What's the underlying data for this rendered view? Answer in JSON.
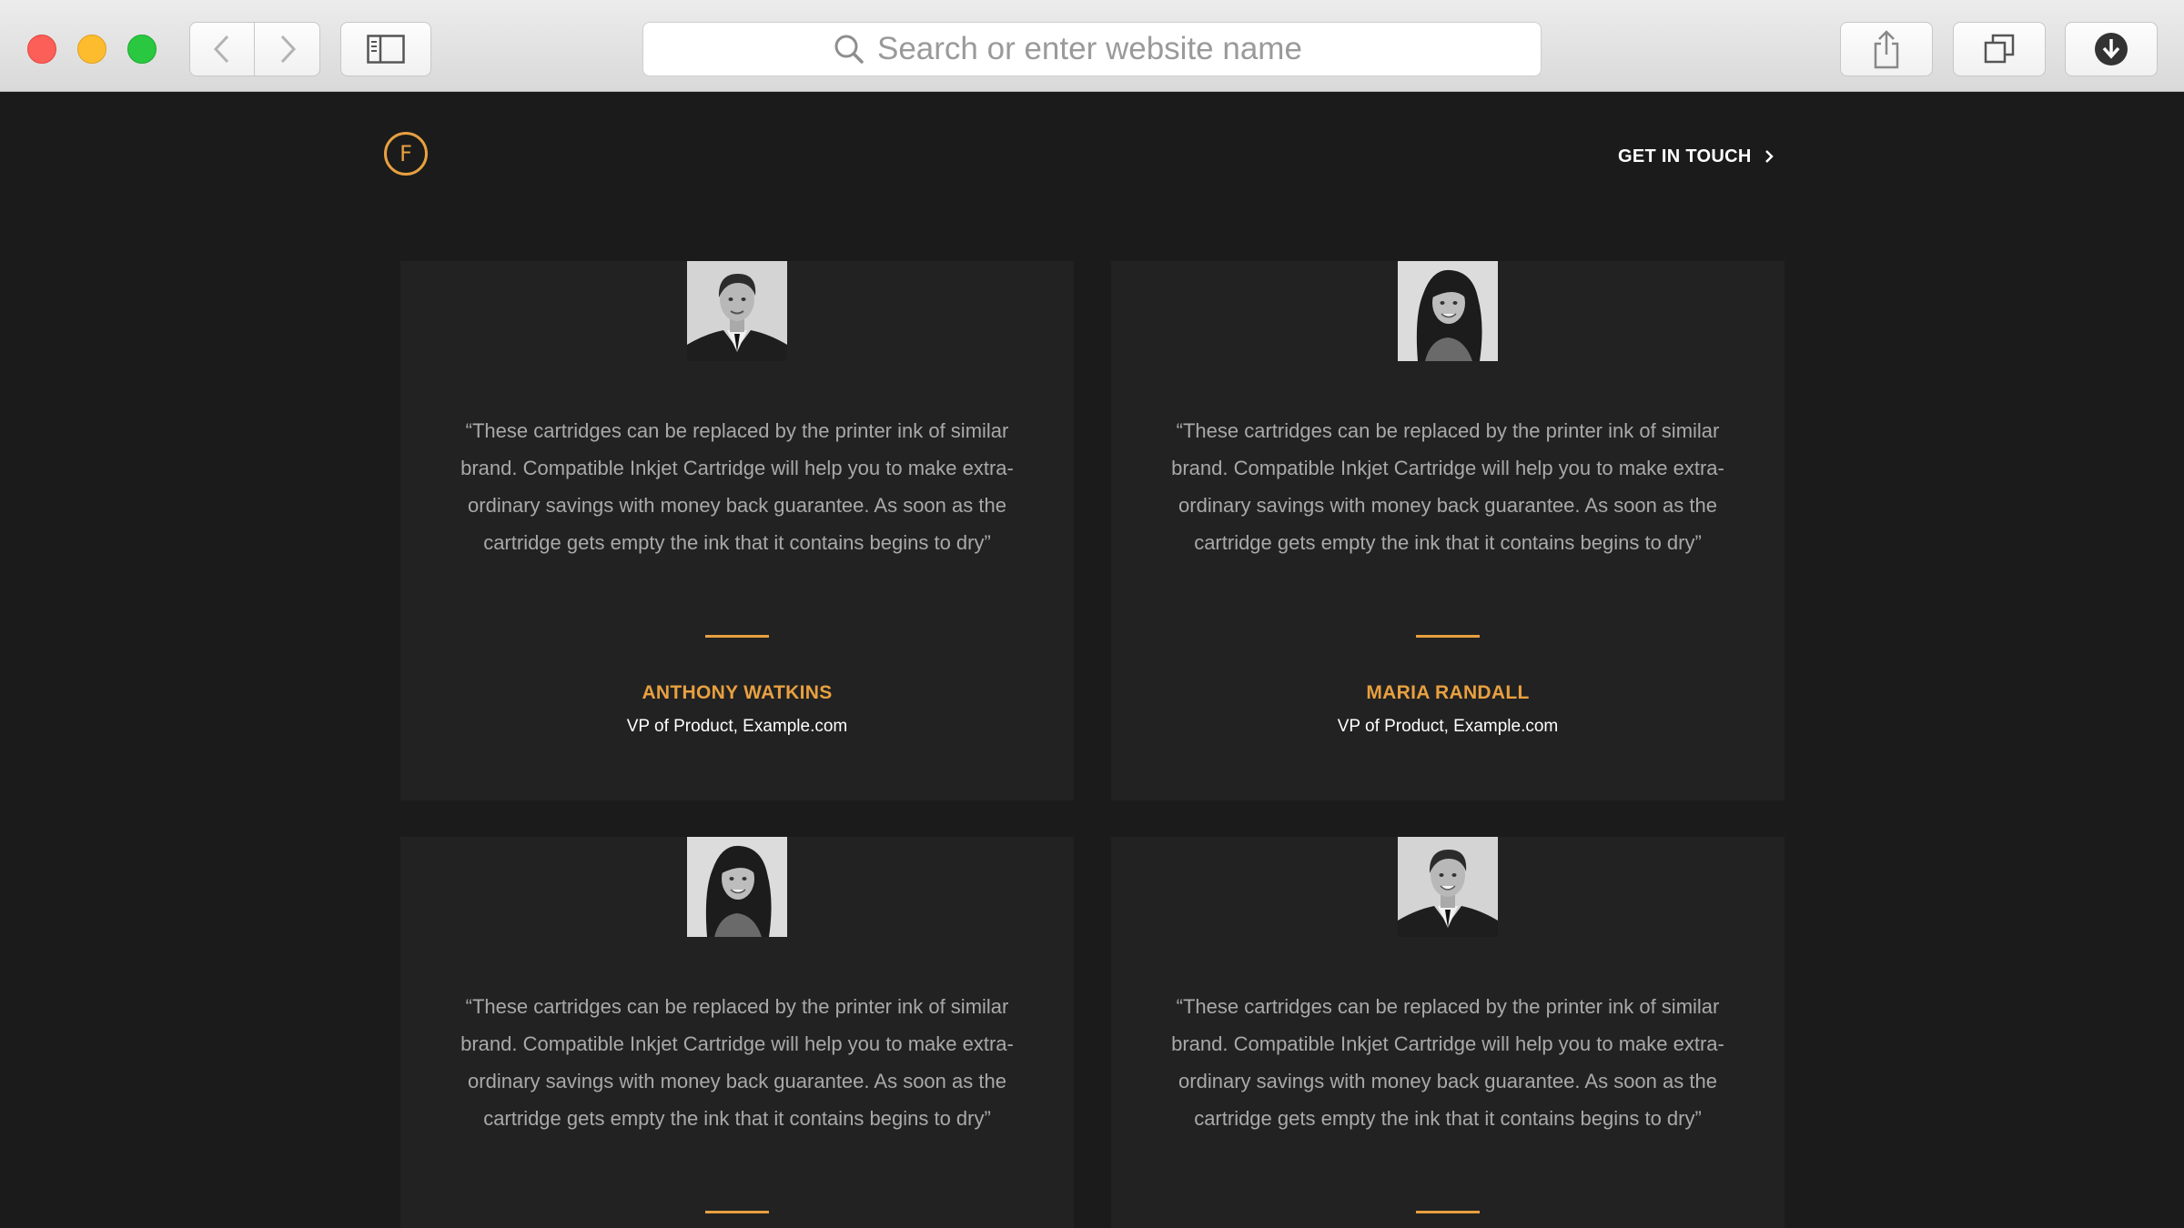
{
  "browser": {
    "address_placeholder": "Search or enter website name"
  },
  "site": {
    "logo_letter": "F",
    "nav_cta": "GET IN TOUCH"
  },
  "testimonials": [
    {
      "quote": "“These cartridges can be replaced by the printer ink of similar brand. Compatible Inkjet Cartridge will help you to make extra-ordinary savings with money back guarantee. As soon as the cartridge gets empty the ink that it contains begins to dry”",
      "name": "ANTHONY WATKINS",
      "role": "VP of Product, Example.com",
      "avatar": "man-portrait"
    },
    {
      "quote": "“These cartridges can be replaced by the printer ink of similar brand. Compatible Inkjet Cartridge will help you to make extra-ordinary savings with money back guarantee. As soon as the cartridge gets empty the ink that it contains begins to dry”",
      "name": "MARIA RANDALL",
      "role": "VP of Product, Example.com",
      "avatar": "woman-portrait"
    },
    {
      "quote": "“These cartridges can be replaced by the printer ink of similar brand. Compatible Inkjet Cartridge will help you to make extra-ordinary savings with money back guarantee. As soon as the cartridge gets empty the ink that it contains begins to dry”",
      "avatar": "woman-portrait"
    },
    {
      "quote": "“These cartridges can be replaced by the printer ink of similar brand. Compatible Inkjet Cartridge will help you to make extra-ordinary savings with money back guarantee. As soon as the cartridge gets empty the ink that it contains begins to dry”",
      "avatar": "man-portrait"
    }
  ],
  "colors": {
    "accent": "#e8a040",
    "page_background": "#1b1b1b",
    "card_background": "#222222"
  }
}
